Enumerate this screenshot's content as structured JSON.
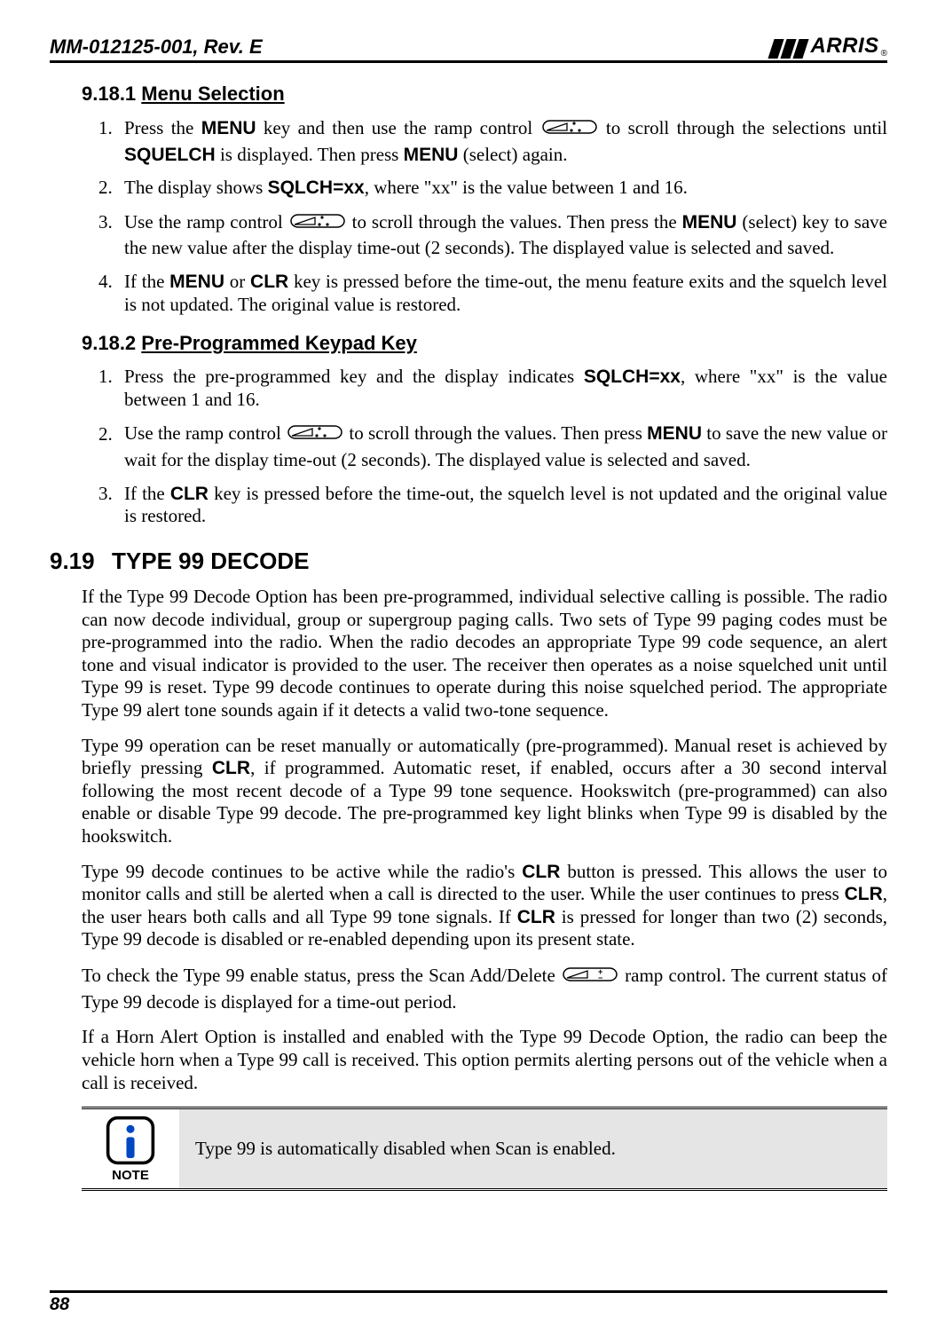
{
  "header": {
    "docnum": "MM-012125-001, Rev. E",
    "logo_text": "ARRIS",
    "logo_reg": "®"
  },
  "sections": {
    "s1": {
      "num": "9.18.1",
      "title": "Menu Selection",
      "items": [
        {
          "pre": "Press the ",
          "b1": "MENU",
          "mid1": " key and then use the ramp control ",
          "mid2": " to scroll through the selections until ",
          "b2": "SQUELCH",
          "mid3": " is displayed. Then press ",
          "b3": "MENU",
          "tail": " (select) again."
        },
        {
          "pre": "The display shows ",
          "b1": "SQLCH=xx",
          "tail": ", where \"xx\" is the value between 1 and 16."
        },
        {
          "pre": "Use the ramp control ",
          "mid1": " to scroll through the values. Then press the ",
          "b1": "MENU",
          "tail": " (select) key to save the new value after the display time-out (2 seconds). The displayed value is selected and saved."
        },
        {
          "pre": "If the ",
          "b1": "MENU",
          "mid1": " or ",
          "b2": "CLR",
          "tail": " key is pressed before the time-out, the menu feature exits and the squelch level is not updated. The original value is restored."
        }
      ]
    },
    "s2": {
      "num": "9.18.2",
      "title": "Pre-Programmed Keypad Key",
      "items": [
        {
          "pre": "Press the pre-programmed key and the display indicates ",
          "b1": "SQLCH=xx",
          "tail": ", where \"xx\" is the value between 1 and 16."
        },
        {
          "pre": "Use the ramp control ",
          "mid1": " to scroll through the values. Then press ",
          "b1": "MENU",
          "tail": " to save the new value or wait for the display time-out (2 seconds). The displayed value is selected and saved."
        },
        {
          "pre": "If the ",
          "b1": "CLR",
          "tail": " key is pressed before the time-out, the squelch level is not updated and the original value is restored."
        }
      ]
    },
    "s3": {
      "num": "9.19",
      "title": "TYPE 99 DECODE",
      "p1": "If the Type 99 Decode Option has been pre-programmed, individual selective calling is possible. The radio can now decode individual, group or supergroup paging calls. Two sets of Type 99 paging codes must be pre-programmed into the radio. When the radio decodes an appropriate Type 99 code sequence, an alert tone and visual indicator is provided to the user. The receiver then operates as a noise squelched unit until Type 99 is reset. Type 99 decode continues to operate during this noise squelched period. The appropriate Type 99 alert tone sounds again if it detects a valid two-tone sequence.",
      "p2a": "Type 99 operation can be reset manually or automatically (pre-programmed). Manual reset is achieved by briefly pressing ",
      "p2b": "CLR",
      "p2c": ", if programmed. Automatic reset, if enabled, occurs after a 30 second interval following the most recent decode of a Type 99 tone sequence. Hookswitch (pre-programmed) can also enable or disable Type 99 decode. The pre-programmed key light blinks when Type 99 is disabled by the hookswitch.",
      "p3a": "Type 99 decode continues to be active while the radio's ",
      "p3b": "CLR",
      "p3c": " button is pressed. This allows the user to monitor calls and still be alerted when a call is directed to the user. While the user continues to press ",
      "p3d": "CLR",
      "p3e": ", the user hears both calls and all Type 99 tone signals. If ",
      "p3f": "CLR",
      "p3g": " is pressed for longer than two (2) seconds, Type 99 decode is disabled or re-enabled depending upon its present state.",
      "p4a": "To check the Type 99 enable status, press the Scan Add/Delete ",
      "p4b": " ramp control. The current status of Type 99 decode is displayed for a time-out period.",
      "p5": "If a Horn Alert Option is installed and enabled with the Type 99 Decode Option, the radio can beep the vehicle horn when a Type 99 call is received. This option permits alerting persons out of the vehicle when a call is received."
    },
    "note": {
      "label": "NOTE",
      "text": "Type 99 is automatically disabled when Scan is enabled."
    }
  },
  "pagenum": "88"
}
